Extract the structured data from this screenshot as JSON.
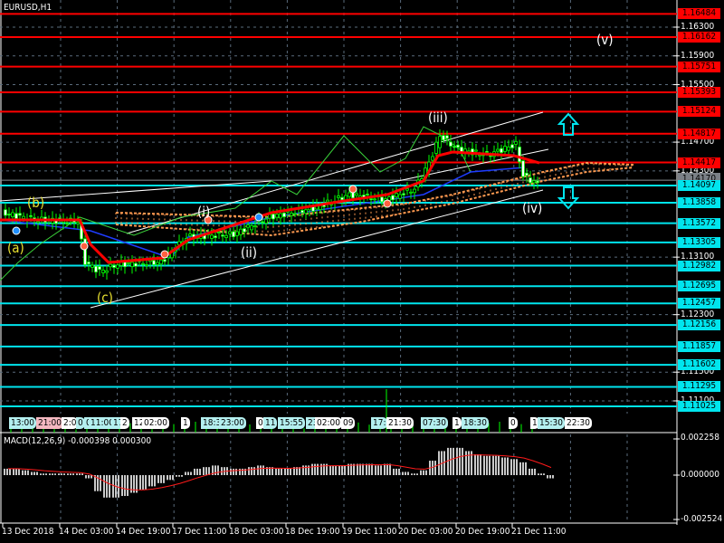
{
  "title": "EURUSD,H1",
  "colors": {
    "background": "#000000",
    "resistance": "#ff0000",
    "support": "#00e5ee",
    "candle": "#00ff00",
    "ma_red": "#ff0000",
    "ma_blue": "#1e3cff",
    "cloud": "#ff9a50",
    "grid": "#5a6b7c"
  },
  "resistance_levels": [
    "1.16484",
    "1.16162",
    "1.15751",
    "1.15393",
    "1.15124",
    "1.14817",
    "1.14417"
  ],
  "support_levels": [
    "1.14097",
    "1.13858",
    "1.13572",
    "1.13305",
    "1.12982",
    "1.12695",
    "1.12457",
    "1.12156",
    "1.11857",
    "1.11602",
    "1.11295",
    "1.11025"
  ],
  "current_price": "1.14170",
  "price_ticks": [
    "1.16300",
    "1.15900",
    "1.15500",
    "1.14700",
    "1.14300",
    "1.13100",
    "1.12300",
    "1.11500",
    "1.11100"
  ],
  "wave_labels": {
    "a": "(a)",
    "b": "(b)",
    "c": "(c)",
    "i": "(i)",
    "ii": "(ii)",
    "iii": "(iii)",
    "iv": "(iv)",
    "v": "(v)"
  },
  "time_labels": [
    "13:00",
    "21:00",
    "2:0",
    "0",
    "0",
    "11:00",
    "17",
    "2",
    "12",
    "02:00",
    "1",
    "18:3",
    "23:00",
    "0",
    "11",
    "15:55",
    "23",
    "02:00",
    "09",
    "17:",
    "21:30",
    "07:30",
    "1",
    "18:30",
    "0",
    "1",
    "15:30",
    "22:30"
  ],
  "macd": {
    "label": "MACD(12,26,9) -0.000398 0.000300",
    "max": "0.002258",
    "zero": "0.000000",
    "min": "-0.002524"
  },
  "x_axis": [
    "13 Dec 2018",
    "14 Dec 03:00",
    "14 Dec 19:00",
    "17 Dec 11:00",
    "18 Dec 03:00",
    "18 Dec 19:00",
    "19 Dec 11:00",
    "20 Dec 03:00",
    "20 Dec 19:00",
    "21 Dec 11:00"
  ],
  "chart_data": {
    "type": "line",
    "symbol": "EURUSD",
    "timeframe": "H1",
    "price_path": [
      [
        1,
        1.1372
      ],
      [
        10,
        1.1362
      ],
      [
        22,
        1.136
      ],
      [
        24,
        1.1303
      ],
      [
        28,
        1.129
      ],
      [
        33,
        1.13
      ],
      [
        45,
        1.1303
      ],
      [
        52,
        1.1338
      ],
      [
        65,
        1.1342
      ],
      [
        75,
        1.1366
      ],
      [
        87,
        1.1378
      ],
      [
        97,
        1.1397
      ],
      [
        107,
        1.139
      ],
      [
        115,
        1.1405
      ],
      [
        119,
        1.1441
      ],
      [
        122,
        1.1479
      ],
      [
        127,
        1.146
      ],
      [
        135,
        1.1452
      ],
      [
        143,
        1.1467
      ],
      [
        145,
        1.1423
      ],
      [
        149,
        1.1412
      ]
    ],
    "ma_red": [
      [
        0,
        1.13618
      ],
      [
        22,
        1.13618
      ],
      [
        25,
        1.13278
      ],
      [
        30,
        1.13026
      ],
      [
        45,
        1.13089
      ],
      [
        52,
        1.13341
      ],
      [
        75,
        1.13719
      ],
      [
        95,
        1.13882
      ],
      [
        107,
        1.13971
      ],
      [
        117,
        1.1416
      ],
      [
        121,
        1.14512
      ],
      [
        125,
        1.14562
      ],
      [
        142,
        1.14512
      ],
      [
        149,
        1.14411
      ]
    ],
    "ma_blue": [
      [
        0,
        1.13618
      ],
      [
        25,
        1.13467
      ],
      [
        47,
        1.13089
      ],
      [
        52,
        1.13379
      ],
      [
        75,
        1.13656
      ],
      [
        100,
        1.13845
      ],
      [
        117,
        1.13971
      ],
      [
        130,
        1.14285
      ],
      [
        145,
        1.14348
      ]
    ],
    "chikou": [
      [
        0,
        1.12774
      ],
      [
        5,
        1.13026
      ],
      [
        11,
        1.13278
      ],
      [
        22,
        1.13656
      ],
      [
        37,
        1.13404
      ],
      [
        50,
        1.13656
      ],
      [
        65,
        1.13782
      ],
      [
        75,
        1.1416
      ],
      [
        82,
        1.13971
      ],
      [
        95,
        1.14789
      ],
      [
        105,
        1.14285
      ],
      [
        112,
        1.14474
      ],
      [
        117,
        1.14915
      ],
      [
        122,
        1.14789
      ],
      [
        127,
        1.146
      ],
      [
        130,
        1.14285
      ]
    ],
    "cloud_upper": [
      [
        32,
        1.13719
      ],
      [
        75,
        1.13656
      ],
      [
        100,
        1.13782
      ],
      [
        112,
        1.13845
      ],
      [
        125,
        1.13971
      ],
      [
        150,
        1.14285
      ],
      [
        162,
        1.14411
      ],
      [
        175,
        1.14386
      ]
    ],
    "cloud_lower": [
      [
        32,
        1.13555
      ],
      [
        75,
        1.13404
      ],
      [
        100,
        1.13593
      ],
      [
        112,
        1.13719
      ],
      [
        125,
        1.13845
      ],
      [
        150,
        1.1416
      ],
      [
        162,
        1.14285
      ],
      [
        175,
        1.14348
      ]
    ],
    "macd_hist": [
      0.0004,
      0.0004,
      0.0003,
      0.0002,
      0.0001,
      0.0001,
      0.0001,
      0.0001,
      0.0001,
      -0.0002,
      -0.001,
      -0.0014,
      -0.0014,
      -0.0013,
      -0.0011,
      -0.0009,
      -0.0007,
      -0.0005,
      -0.0003,
      -0.0001,
      0.0002,
      0.0004,
      0.0005,
      0.0006,
      0.0005,
      0.0004,
      0.0004,
      0.0005,
      0.0006,
      0.0005,
      0.0004,
      0.0004,
      0.0005,
      0.0006,
      0.0007,
      0.0007,
      0.0006,
      0.0006,
      0.0007,
      0.0007,
      0.0007,
      0.0006,
      0.0007,
      0.0004,
      0.0002,
      0.0001,
      0.0003,
      0.0009,
      0.0015,
      0.0017,
      0.0017,
      0.0015,
      0.0013,
      0.0012,
      0.0012,
      0.0011,
      0.001,
      0.0008,
      0.0004,
      0.0001,
      -0.0002
    ],
    "ylim": [
      1.1095,
      1.1665
    ]
  }
}
